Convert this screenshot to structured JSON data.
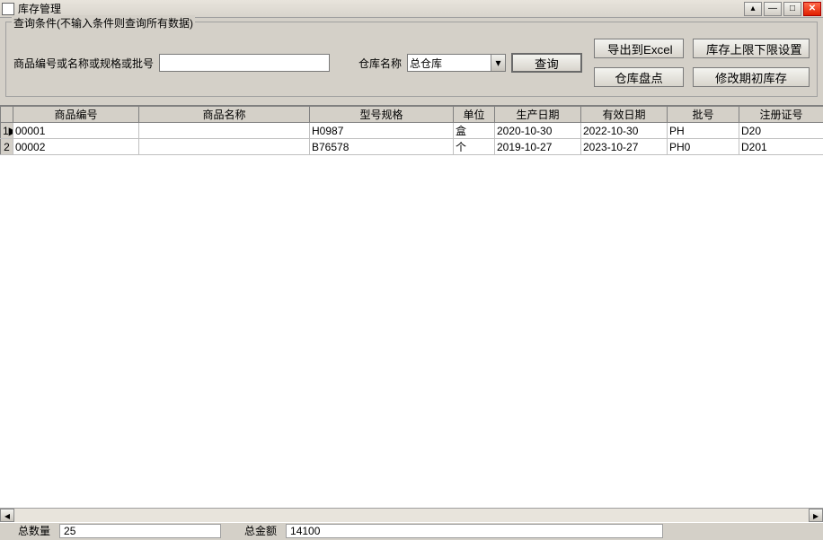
{
  "window": {
    "title": "库存管理"
  },
  "filter": {
    "legend": "查询条件(不输入条件则查询所有数据)",
    "label_code": "商品编号或名称或规格或批号",
    "input_value": "",
    "label_warehouse": "仓库名称",
    "warehouse_value": "总仓库",
    "btn_query": "查询",
    "btn_export": "导出到Excel",
    "btn_limits": "库存上限下限设置",
    "btn_check": "仓库盘点",
    "btn_modify": "修改期初库存"
  },
  "table": {
    "headers": [
      "商品编号",
      "商品名称",
      "型号规格",
      "单位",
      "生产日期",
      "有效日期",
      "批号",
      "注册证号"
    ],
    "rows": [
      {
        "n": "1",
        "sel": "▶",
        "code": "00001",
        "name": "",
        "spec": "H0987",
        "unit": "盒",
        "pdate": "2020-10-30",
        "edate": "2022-10-30",
        "batch": "PH     ",
        "reg": "D20      "
      },
      {
        "n": "2",
        "sel": "",
        "code": "00002",
        "name": "",
        "spec": "B76578",
        "unit": "个",
        "pdate": "2019-10-27",
        "edate": "2023-10-27",
        "batch": "PH0   ",
        "reg": "D201     "
      }
    ]
  },
  "status": {
    "label_qty": "总数量",
    "qty": "25",
    "label_amount": "总金额",
    "amount": "14100"
  }
}
